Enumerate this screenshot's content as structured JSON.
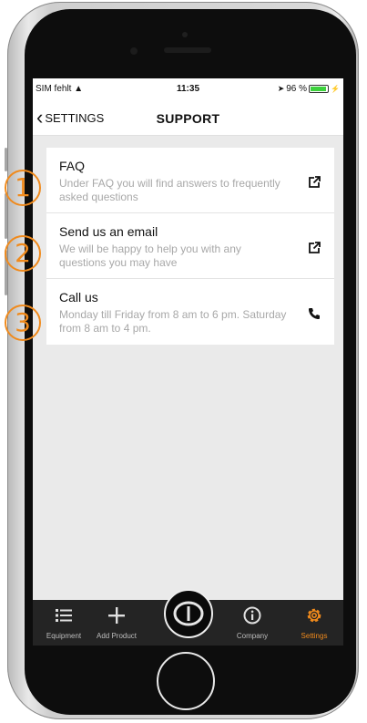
{
  "status": {
    "carrier": "SIM fehlt",
    "time": "11:35",
    "battery": "96 %",
    "battery_level": 0.96
  },
  "nav": {
    "back_label": "SETTINGS",
    "title": "SUPPORT"
  },
  "items": [
    {
      "title": "FAQ",
      "desc": "Under FAQ you will find answers to frequently asked questions",
      "marker": "1",
      "icon": "external-link-icon"
    },
    {
      "title": "Send us an email",
      "desc": "We will be happy to help you with any questions you may have",
      "marker": "2",
      "icon": "external-link-icon"
    },
    {
      "title": "Call us",
      "desc": "Monday till Friday from 8 am to 6 pm. Saturday from 8 am to 4 pm.",
      "marker": "3",
      "icon": "phone-icon"
    }
  ],
  "tabs": [
    {
      "label": "Equipment",
      "icon": "list-icon"
    },
    {
      "label": "Add Product",
      "icon": "plus-icon"
    },
    {
      "label": "Company",
      "icon": "info-icon"
    },
    {
      "label": "Settings",
      "icon": "gear-icon"
    }
  ],
  "colors": {
    "accent": "#f08a1c",
    "tabbar": "#242424",
    "background": "#eaeaea"
  }
}
